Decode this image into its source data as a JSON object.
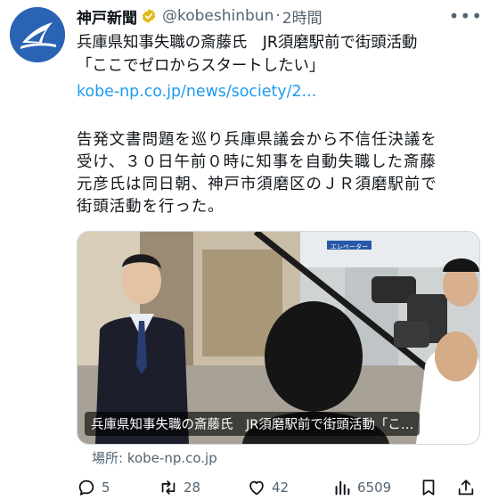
{
  "post": {
    "author": {
      "display_name": "神戸新聞",
      "handle": "@kobeshinbun",
      "separator": "·",
      "time": "2時間"
    },
    "headline_line1": "兵庫県知事失職の斎藤氏　JR須磨駅前で街頭活動",
    "headline_line2": "「ここでゼロからスタートしたい」",
    "link_text": "kobe-np.co.jp/news/society/2...",
    "body_lines": [
      "告発文書問題を巡り兵庫県議会から不信任決議を",
      "受け、３０日午前０時に知事を自動失職した斎藤",
      "元彦氏は同日朝、神戸市須磨区のＪＲ須磨駅前で",
      "街頭活動を行った。"
    ],
    "media_caption": "兵庫県知事失職の斎藤氏　JR須磨駅前で街頭活動「こ…",
    "station_sign": "エレベーター",
    "source_label": "場所: kobe-np.co.jp"
  },
  "actions": {
    "replies": "5",
    "reposts": "28",
    "likes": "42",
    "views": "6509"
  },
  "icons": [
    "verified-badge-icon",
    "more-icon",
    "reply-icon",
    "repost-icon",
    "like-icon",
    "views-icon",
    "bookmark-icon",
    "share-icon"
  ],
  "colors": {
    "accent": "#1d9bf0",
    "text": "#0f1419",
    "muted": "#536471",
    "avatar_bg": "#2a63b4"
  }
}
